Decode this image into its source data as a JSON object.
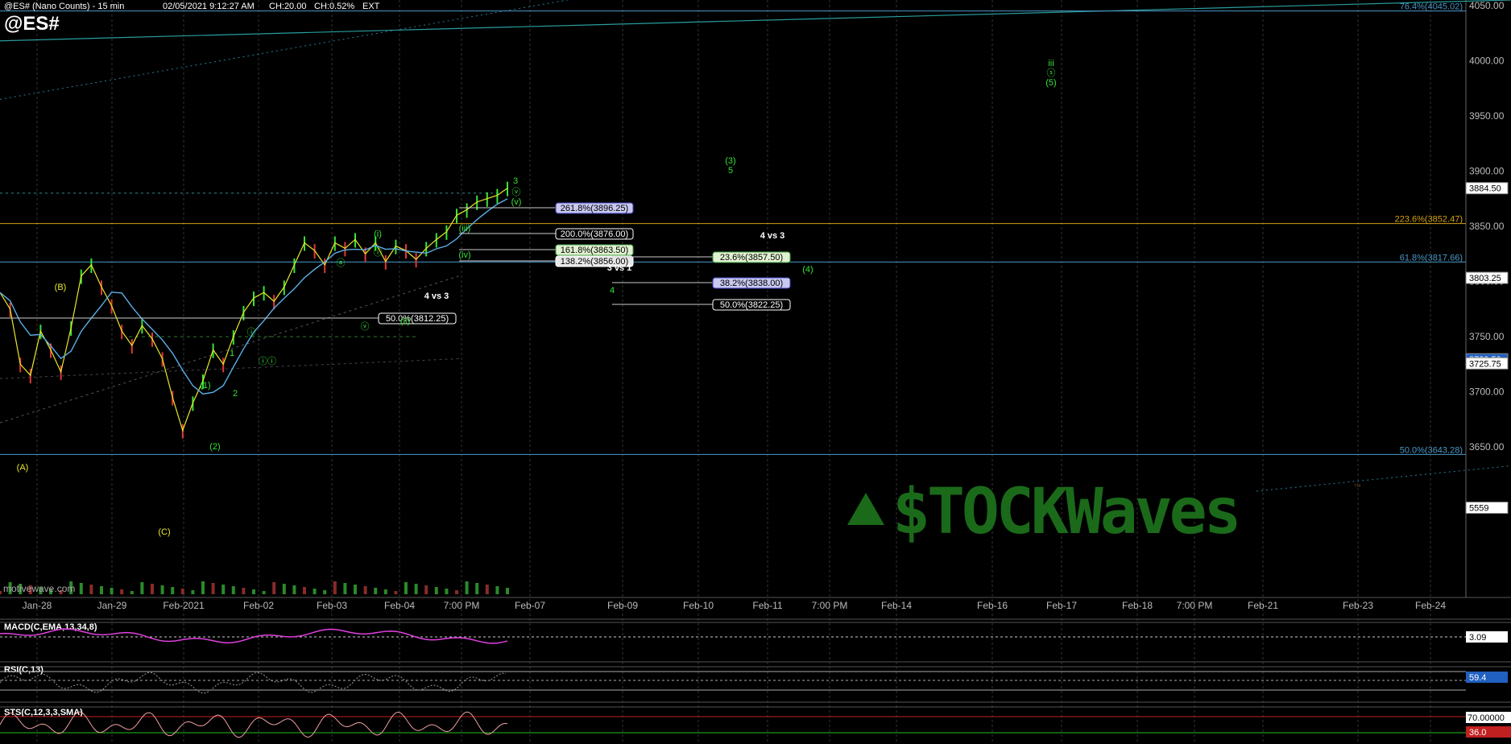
{
  "header": {
    "title": "@ES# (Nano Counts) - 15 min",
    "datetime": "02/05/2021 9:12:27 AM",
    "change": "CH:20.00",
    "change_pct": "CH:0.52%",
    "session": "EXT",
    "symbol": "@ES#"
  },
  "watermark": {
    "source": "motivewave.com",
    "logo": "$TOCKWaves",
    "logo_tm": "™"
  },
  "chart_data": {
    "type": "line",
    "title": "@ES# (Nano Counts) - 15 min",
    "price_axis": {
      "min": 3610,
      "max": 4055,
      "ticks": [
        3650,
        3700,
        3750,
        3800,
        3850,
        3900,
        3950,
        4000,
        4050
      ]
    },
    "x_ticks": [
      "Jan-28",
      "Jan-29",
      "Feb-2021",
      "Feb-02",
      "Feb-03",
      "Feb-04",
      "7:00 PM",
      "Feb-07",
      "Feb-09",
      "Feb-10",
      "Feb-11",
      "7:00 PM",
      "Feb-14",
      "Feb-16",
      "Feb-17",
      "Feb-18",
      "7:00 PM",
      "Feb-21",
      "Feb-23",
      "Feb-24"
    ],
    "price_series": [
      3790,
      3775,
      3725,
      3715,
      3755,
      3738,
      3718,
      3758,
      3805,
      3815,
      3795,
      3778,
      3755,
      3742,
      3760,
      3748,
      3730,
      3695,
      3665,
      3690,
      3710,
      3738,
      3725,
      3750,
      3772,
      3785,
      3790,
      3782,
      3795,
      3815,
      3835,
      3828,
      3815,
      3835,
      3830,
      3838,
      3825,
      3835,
      3818,
      3832,
      3828,
      3820,
      3830,
      3838,
      3845,
      3860,
      3865,
      3872,
      3875,
      3878,
      3884.5
    ],
    "price_tags": [
      {
        "value": 3884.5,
        "label": "3884.50",
        "style": "white"
      },
      {
        "value": 3803.25,
        "label": "3803.25",
        "style": "white"
      },
      {
        "value": 3729.5,
        "label": "3729.50",
        "style": "blue"
      },
      {
        "value": 3725.75,
        "label": "3725.75",
        "style": "white"
      },
      {
        "value": 3595,
        "label": "5559",
        "style": "white"
      }
    ],
    "levels": [
      {
        "label": "76.4%(4045.02)",
        "value": 4045.02,
        "color": "#4a98c8"
      },
      {
        "label": "223.6%(3852.47)",
        "value": 3852.47,
        "color": "#d4a017"
      },
      {
        "label": "61.8%(3817.66)",
        "value": 3817.66,
        "color": "#4a98c8"
      },
      {
        "label": "50.0%(3643.28)",
        "value": 3643.28,
        "color": "#4a98c8"
      }
    ],
    "fib_boxes": [
      {
        "label": "261.8%(3896.25)",
        "value": 3896.25,
        "bg": "#c8c8f0",
        "border": "#4040c0",
        "fg": "#000"
      },
      {
        "label": "200.0%(3876.00)",
        "value": 3876.0,
        "bg": "#000",
        "border": "#fff",
        "fg": "#fff"
      },
      {
        "label": "161.8%(3863.50)",
        "value": 3863.5,
        "bg": "#e0f0d0",
        "border": "#40a040",
        "fg": "#000"
      },
      {
        "label": "138.2%(3856.00)",
        "value": 3856.0,
        "bg": "#e8e8e8",
        "border": "#fff",
        "fg": "#000"
      },
      {
        "label": "23.6%(3857.50)",
        "value": 3857.5,
        "bg": "#e0f0d0",
        "border": "#40a040",
        "fg": "#000"
      },
      {
        "label": "38.2%(3838.00)",
        "value": 3838.0,
        "bg": "#c8c8f0",
        "border": "#4040c0",
        "fg": "#000"
      },
      {
        "label": "50.0%(3822.25)",
        "value": 3822.25,
        "bg": "#000",
        "border": "#fff",
        "fg": "#fff"
      },
      {
        "label": "50.0%(3812.25)",
        "value": 3812.25,
        "bg": "#000",
        "border": "#fff",
        "fg": "#fff"
      }
    ],
    "wave_labels": [
      {
        "text": "(B)",
        "color": "#e8e82a"
      },
      {
        "text": "(A)",
        "color": "#e8e82a"
      },
      {
        "text": "(C)",
        "color": "#e8e82a"
      },
      {
        "text": "ⓐ",
        "color": "#37e337"
      },
      {
        "text": "(1)",
        "color": "#37e337"
      },
      {
        "text": "(2)",
        "color": "#37e337"
      },
      {
        "text": "1",
        "color": "#37e337"
      },
      {
        "text": "2",
        "color": "#37e337"
      },
      {
        "text": "ⓘ",
        "color": "#37e337"
      },
      {
        "text": "ⓘⓘ",
        "color": "#37e337"
      },
      {
        "text": "ⓘ",
        "color": "#37e337"
      },
      {
        "text": "(i)",
        "color": "#37e337"
      },
      {
        "text": "ⓥ",
        "color": "#37e337"
      },
      {
        "text": "(ii)",
        "color": "#37e337"
      },
      {
        "text": "4 vs 3",
        "color": "#ffffff"
      },
      {
        "text": "(iii)",
        "color": "#37e337"
      },
      {
        "text": "(iv)",
        "color": "#37e337"
      },
      {
        "text": "3",
        "color": "#37e337"
      },
      {
        "text": "ⓥ",
        "color": "#37e337"
      },
      {
        "text": "(v)",
        "color": "#37e337"
      },
      {
        "text": "(3)",
        "color": "#37e337"
      },
      {
        "text": "5",
        "color": "#37e337"
      },
      {
        "text": "4 vs 3",
        "color": "#ffffff"
      },
      {
        "text": "3 vs 1",
        "color": "#ffffff"
      },
      {
        "text": "4",
        "color": "#37e337"
      },
      {
        "text": "(4)",
        "color": "#37e337"
      },
      {
        "text": "iii",
        "color": "#37e337"
      },
      {
        "text": "ⓢ",
        "color": "#37e337"
      },
      {
        "text": "(5)",
        "color": "#37e337"
      }
    ],
    "indicators": [
      {
        "name": "MACD(C,EMA,13,34,8)",
        "value": "3.09",
        "tag_style": "white"
      },
      {
        "name": "RSI(C,13)",
        "value": "59.4",
        "tag_style": "blue"
      },
      {
        "name": "STS(C,12,3,3,SMA)",
        "value_top": "70.00000",
        "value_bottom": "36.0"
      }
    ]
  }
}
